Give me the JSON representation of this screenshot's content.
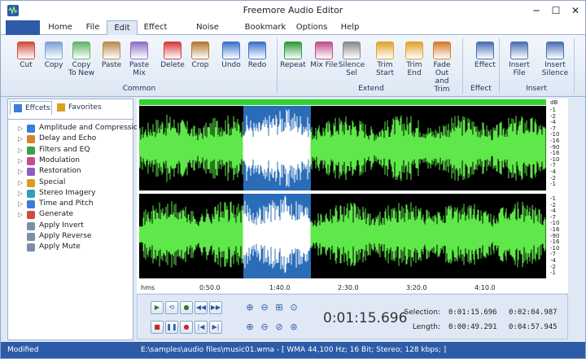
{
  "window": {
    "title": "Freemore Audio Editor",
    "minimize": "─",
    "maximize": "☐",
    "close": "✕"
  },
  "menu": {
    "tabs": [
      "Home",
      "File",
      "Edit",
      "Effect",
      "Noise Reduction",
      "Bookmark",
      "Options",
      "Help"
    ],
    "active": "Edit"
  },
  "ribbon": {
    "buttons": [
      {
        "label": "Cut",
        "icon": "scissors-icon",
        "color": "#d14b3c"
      },
      {
        "label": "Copy",
        "icon": "copy-icon",
        "color": "#7aa1d8"
      },
      {
        "label": "Copy To New",
        "icon": "copy-to-new-icon",
        "color": "#5fb36b"
      },
      {
        "label": "Paste",
        "icon": "paste-icon",
        "color": "#b98a4f"
      },
      {
        "label": "Paste Mix",
        "icon": "paste-mix-icon",
        "color": "#8e6fc4"
      },
      {
        "label": "Delete",
        "icon": "delete-icon",
        "color": "#d63b3b"
      },
      {
        "label": "Crop",
        "icon": "crop-icon",
        "color": "#b07a2e"
      },
      {
        "label": "Undo",
        "icon": "undo-icon",
        "color": "#3c73c9"
      },
      {
        "label": "Redo",
        "icon": "redo-icon",
        "color": "#3c73c9"
      },
      {
        "label": "Repeat",
        "icon": "repeat-icon",
        "color": "#2f9a3c"
      },
      {
        "label": "Mix File",
        "icon": "mix-file-icon",
        "color": "#c24f8b"
      },
      {
        "label": "Silence Sel",
        "icon": "silence-icon",
        "color": "#8a8a8a"
      },
      {
        "label": "Trim Start",
        "icon": "trim-start-icon",
        "color": "#e0a32a"
      },
      {
        "label": "Trim End",
        "icon": "trim-end-icon",
        "color": "#e0a32a"
      },
      {
        "label": "Fade Out and Trim",
        "icon": "fade-trim-icon",
        "color": "#d97a2a"
      },
      {
        "label": "Effect",
        "icon": "effect-icon",
        "color": "#4a6fb3"
      },
      {
        "label": "Insert File",
        "icon": "insert-file-icon",
        "color": "#4a6fb3"
      },
      {
        "label": "Insert Silence",
        "icon": "insert-silence-icon",
        "color": "#4a6fb3"
      }
    ],
    "groups": [
      "Common",
      "Extend",
      "Effect",
      "Insert"
    ]
  },
  "panel": {
    "tabs": [
      "Effcets",
      "Favorites"
    ],
    "items": [
      {
        "label": "Amplitude and Compression",
        "icon": "amplitude-icon",
        "color": "#3b7dd8"
      },
      {
        "label": "Delay and Echo",
        "icon": "delay-icon",
        "color": "#d9822b"
      },
      {
        "label": "Filters and EQ",
        "icon": "filter-icon",
        "color": "#3aa14a"
      },
      {
        "label": "Modulation",
        "icon": "modulation-icon",
        "color": "#c94b8c"
      },
      {
        "label": "Restoration",
        "icon": "restoration-icon",
        "color": "#8c5fc4"
      },
      {
        "label": "Special",
        "icon": "special-icon",
        "color": "#d6a21e"
      },
      {
        "label": "Stereo Imagery",
        "icon": "stereo-icon",
        "color": "#2f9fbf"
      },
      {
        "label": "Time and Pitch",
        "icon": "time-pitch-icon",
        "color": "#3b7dd8"
      },
      {
        "label": "Generate",
        "icon": "generate-icon",
        "color": "#d14b3c"
      },
      {
        "label": "Apply Invert",
        "icon": "invert-icon",
        "color": "#7c8ea8"
      },
      {
        "label": "Apply Reverse",
        "icon": "reverse-icon",
        "color": "#7c8ea8"
      },
      {
        "label": "Apply Mute",
        "icon": "mute-icon",
        "color": "#7c8ea8"
      }
    ]
  },
  "wave": {
    "db_label": "dB",
    "db_ticks": [
      "-1",
      "-2",
      "-4",
      "-7",
      "-10",
      "-16",
      "-90",
      "-16",
      "-10",
      "-7",
      "-4",
      "-2",
      "-1"
    ],
    "timeline": [
      "hms",
      "0:50.0",
      "1:40.0",
      "2:30.0",
      "3:20.0",
      "4:10.0"
    ],
    "colors": {
      "wave": "#5fe84a",
      "background": "#000000",
      "selection": "#2a6cb8",
      "selected_wave": "#ffffff",
      "overview": "#2fd22f"
    }
  },
  "transport": {
    "position": "0:01:15.696",
    "selection_label": "Selection:",
    "length_label": "Length:",
    "selection_start": "0:01:15.696",
    "selection_end": "0:02:04.987",
    "length_sel": "0:00:49.291",
    "length_total": "0:04:57.945"
  },
  "status": {
    "state": "Modified",
    "file": "E:\\samples\\audio files\\music01.wma - [ WMA 44,100 Hz; 16 Bit; Stereo; 128 kbps; ]"
  }
}
